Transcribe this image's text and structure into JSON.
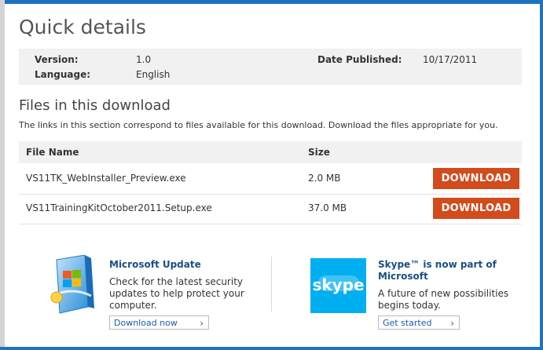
{
  "page": {
    "title": "Quick details"
  },
  "details": {
    "version_label": "Version:",
    "version_value": "1.0",
    "language_label": "Language:",
    "language_value": "English",
    "date_label": "Date Published:",
    "date_value": "10/17/2011"
  },
  "files": {
    "title": "Files in this download",
    "description": "The links in this section correspond to files available for this download. Download the files appropriate for you.",
    "headers": {
      "name": "File Name",
      "size": "Size"
    },
    "rows": [
      {
        "name": "VS11TK_WebInstaller_Preview.exe",
        "size": "2.0 MB",
        "button": "DOWNLOAD"
      },
      {
        "name": "VS11TrainingKitOctober2011.Setup.exe",
        "size": "37.0 MB",
        "button": "DOWNLOAD"
      }
    ]
  },
  "promos": {
    "update": {
      "title": "Microsoft Update",
      "text": [
        "Check for the latest security",
        "updates to help protect your",
        "computer."
      ],
      "link": "Download now"
    },
    "skype": {
      "title": [
        "Skype™ is now part of",
        "Microsoft"
      ],
      "text": [
        "A future of new possibilities",
        "begins today."
      ],
      "link": "Get started",
      "logo_text": "skype"
    }
  },
  "colors": {
    "accent": "#1e73be",
    "download": "#d24b1c",
    "skype": "#00aff0",
    "link": "#1a4f86"
  }
}
